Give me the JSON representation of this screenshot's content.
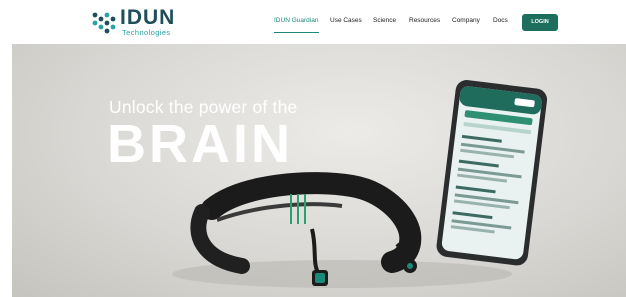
{
  "brand": {
    "name": "IDUN",
    "subtitle": "Technologies"
  },
  "nav": {
    "items": [
      {
        "label": "IDUN Guardian",
        "active": true
      },
      {
        "label": "Use Cases"
      },
      {
        "label": "Science"
      },
      {
        "label": "Resources"
      },
      {
        "label": "Company"
      },
      {
        "label": "Docs"
      }
    ],
    "login_label": "LOGIN"
  },
  "hero": {
    "tagline": "Unlock the power of the",
    "headline": "BRAIN"
  },
  "colors": {
    "brand_dark": "#1f4e5a",
    "brand_teal": "#27a3a0",
    "login_bg": "#1e6e5e"
  }
}
